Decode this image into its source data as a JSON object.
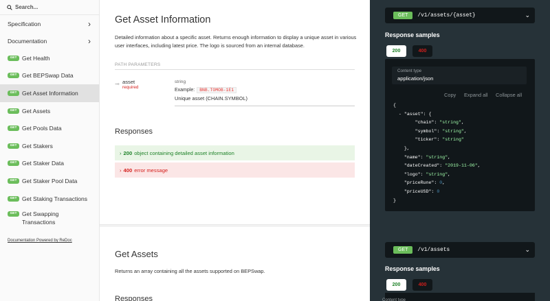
{
  "sidebar": {
    "search_placeholder": "Search...",
    "sections": [
      {
        "label": "Specification"
      },
      {
        "label": "Documentation"
      }
    ],
    "items": [
      {
        "method": "GET",
        "label": "Get Health"
      },
      {
        "method": "GET",
        "label": "Get BEPSwap Data"
      },
      {
        "method": "GET",
        "label": "Get Asset Information"
      },
      {
        "method": "GET",
        "label": "Get Assets"
      },
      {
        "method": "GET",
        "label": "Get Pools Data"
      },
      {
        "method": "GET",
        "label": "Get Stakers"
      },
      {
        "method": "GET",
        "label": "Get Staker Data"
      },
      {
        "method": "GET",
        "label": "Get Staker Pool Data"
      },
      {
        "method": "GET",
        "label": "Get Staking Transactions"
      },
      {
        "method": "GET",
        "label": "Get Swapping Transactions"
      }
    ],
    "active_item": "Get Asset Information",
    "powered_by": "Documentation Powered by ReDoc"
  },
  "main": {
    "title": "Get Asset Information",
    "description": "Detailed information about a specific asset. Returns enough information to display a unique asset in various user interfaces, including latest price. The logo is sourced from an internal database.",
    "path_params_label": "PATH PARAMETERS",
    "param": {
      "name": "asset",
      "required": "required",
      "type": "string",
      "example_label": "Example:",
      "example_value": "BNB.TOMOB-1E1",
      "description": "Unique asset (CHAIN.SYMBOL)"
    },
    "responses_title": "Responses",
    "responses": [
      {
        "code": "200",
        "text": "object containing detailed asset information"
      },
      {
        "code": "400",
        "text": "error message"
      }
    ],
    "next_title": "Get Assets",
    "next_description": "Returns an array containing all the assets supported on BEPSwap.",
    "next_responses_title": "Responses"
  },
  "panel": {
    "endpoint1": {
      "method": "GET",
      "path": "/v1/assets/{asset}"
    },
    "endpoint2": {
      "method": "GET",
      "path": "/v1/assets"
    },
    "samples_title": "Response samples",
    "tab_200": "200",
    "tab_400": "400",
    "content_type_label": "Content type",
    "content_type_value": "application/json",
    "actions": {
      "copy": "Copy",
      "expand": "Expand all",
      "collapse": "Collapse all"
    }
  },
  "colors": {
    "get_badge": "#6bbd5b",
    "active_bg": "#e1e1e1",
    "panel_bg": "#263238",
    "success_bg": "#e9f5e6",
    "error_bg": "#fbe6e6"
  }
}
